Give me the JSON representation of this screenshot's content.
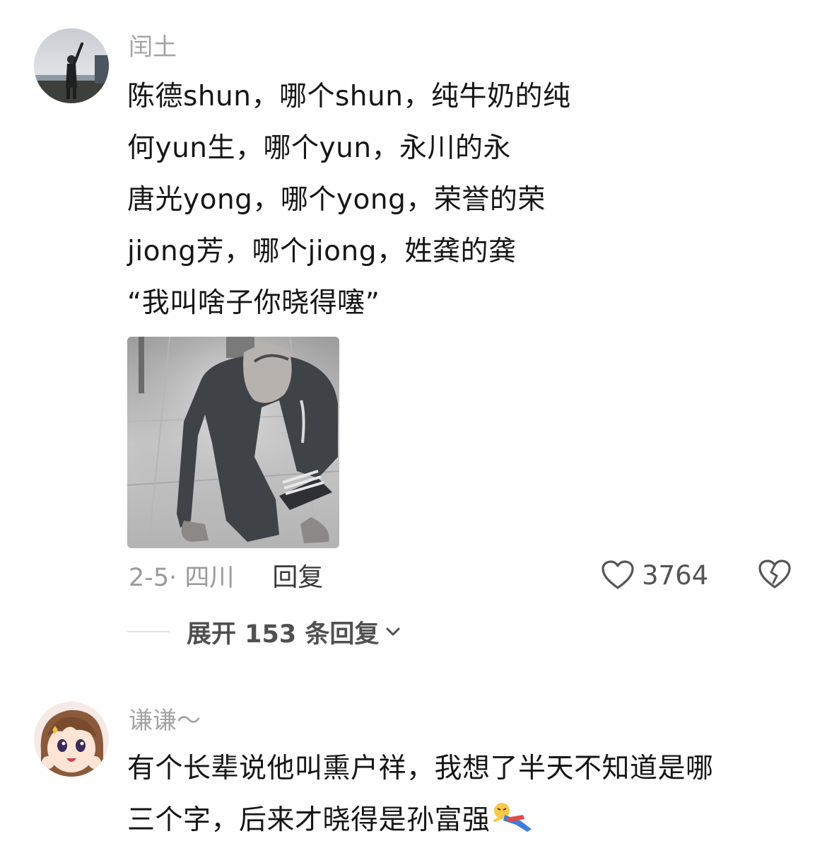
{
  "comments": [
    {
      "username": "闰土",
      "avatar_icon": "avatar-person-landscape",
      "lines": [
        "陈德shun，哪个shun，纯牛奶的纯",
        "何yun生，哪个yun，永川的永",
        "唐光yong，哪个yong，荣誉的荣",
        "jiong芳，哪个jiong，姓龚的龚",
        "“我叫啥子你晓得噻”"
      ],
      "image_icon": "photo-man-kneeling",
      "date_location": "2-5· 四川",
      "reply_label": "回复",
      "like_icon": "heart-outline-icon",
      "like_count": "3764",
      "dislike_icon": "broken-heart-icon",
      "expand_label": "展开 153 条回复",
      "expand_icon": "chevron-down-icon"
    },
    {
      "username": "谦谦～",
      "avatar_icon": "avatar-anime-girl",
      "lines": [
        "有个长辈说他叫熏户祥，我想了半天不知道是哪",
        "三个字，后来才晓得是孙富强"
      ],
      "emoji_icon": "lying-down-emoji-icon"
    }
  ],
  "colors": {
    "text_primary": "#161616",
    "text_secondary": "#a3a3a3",
    "icon": "#555555"
  }
}
